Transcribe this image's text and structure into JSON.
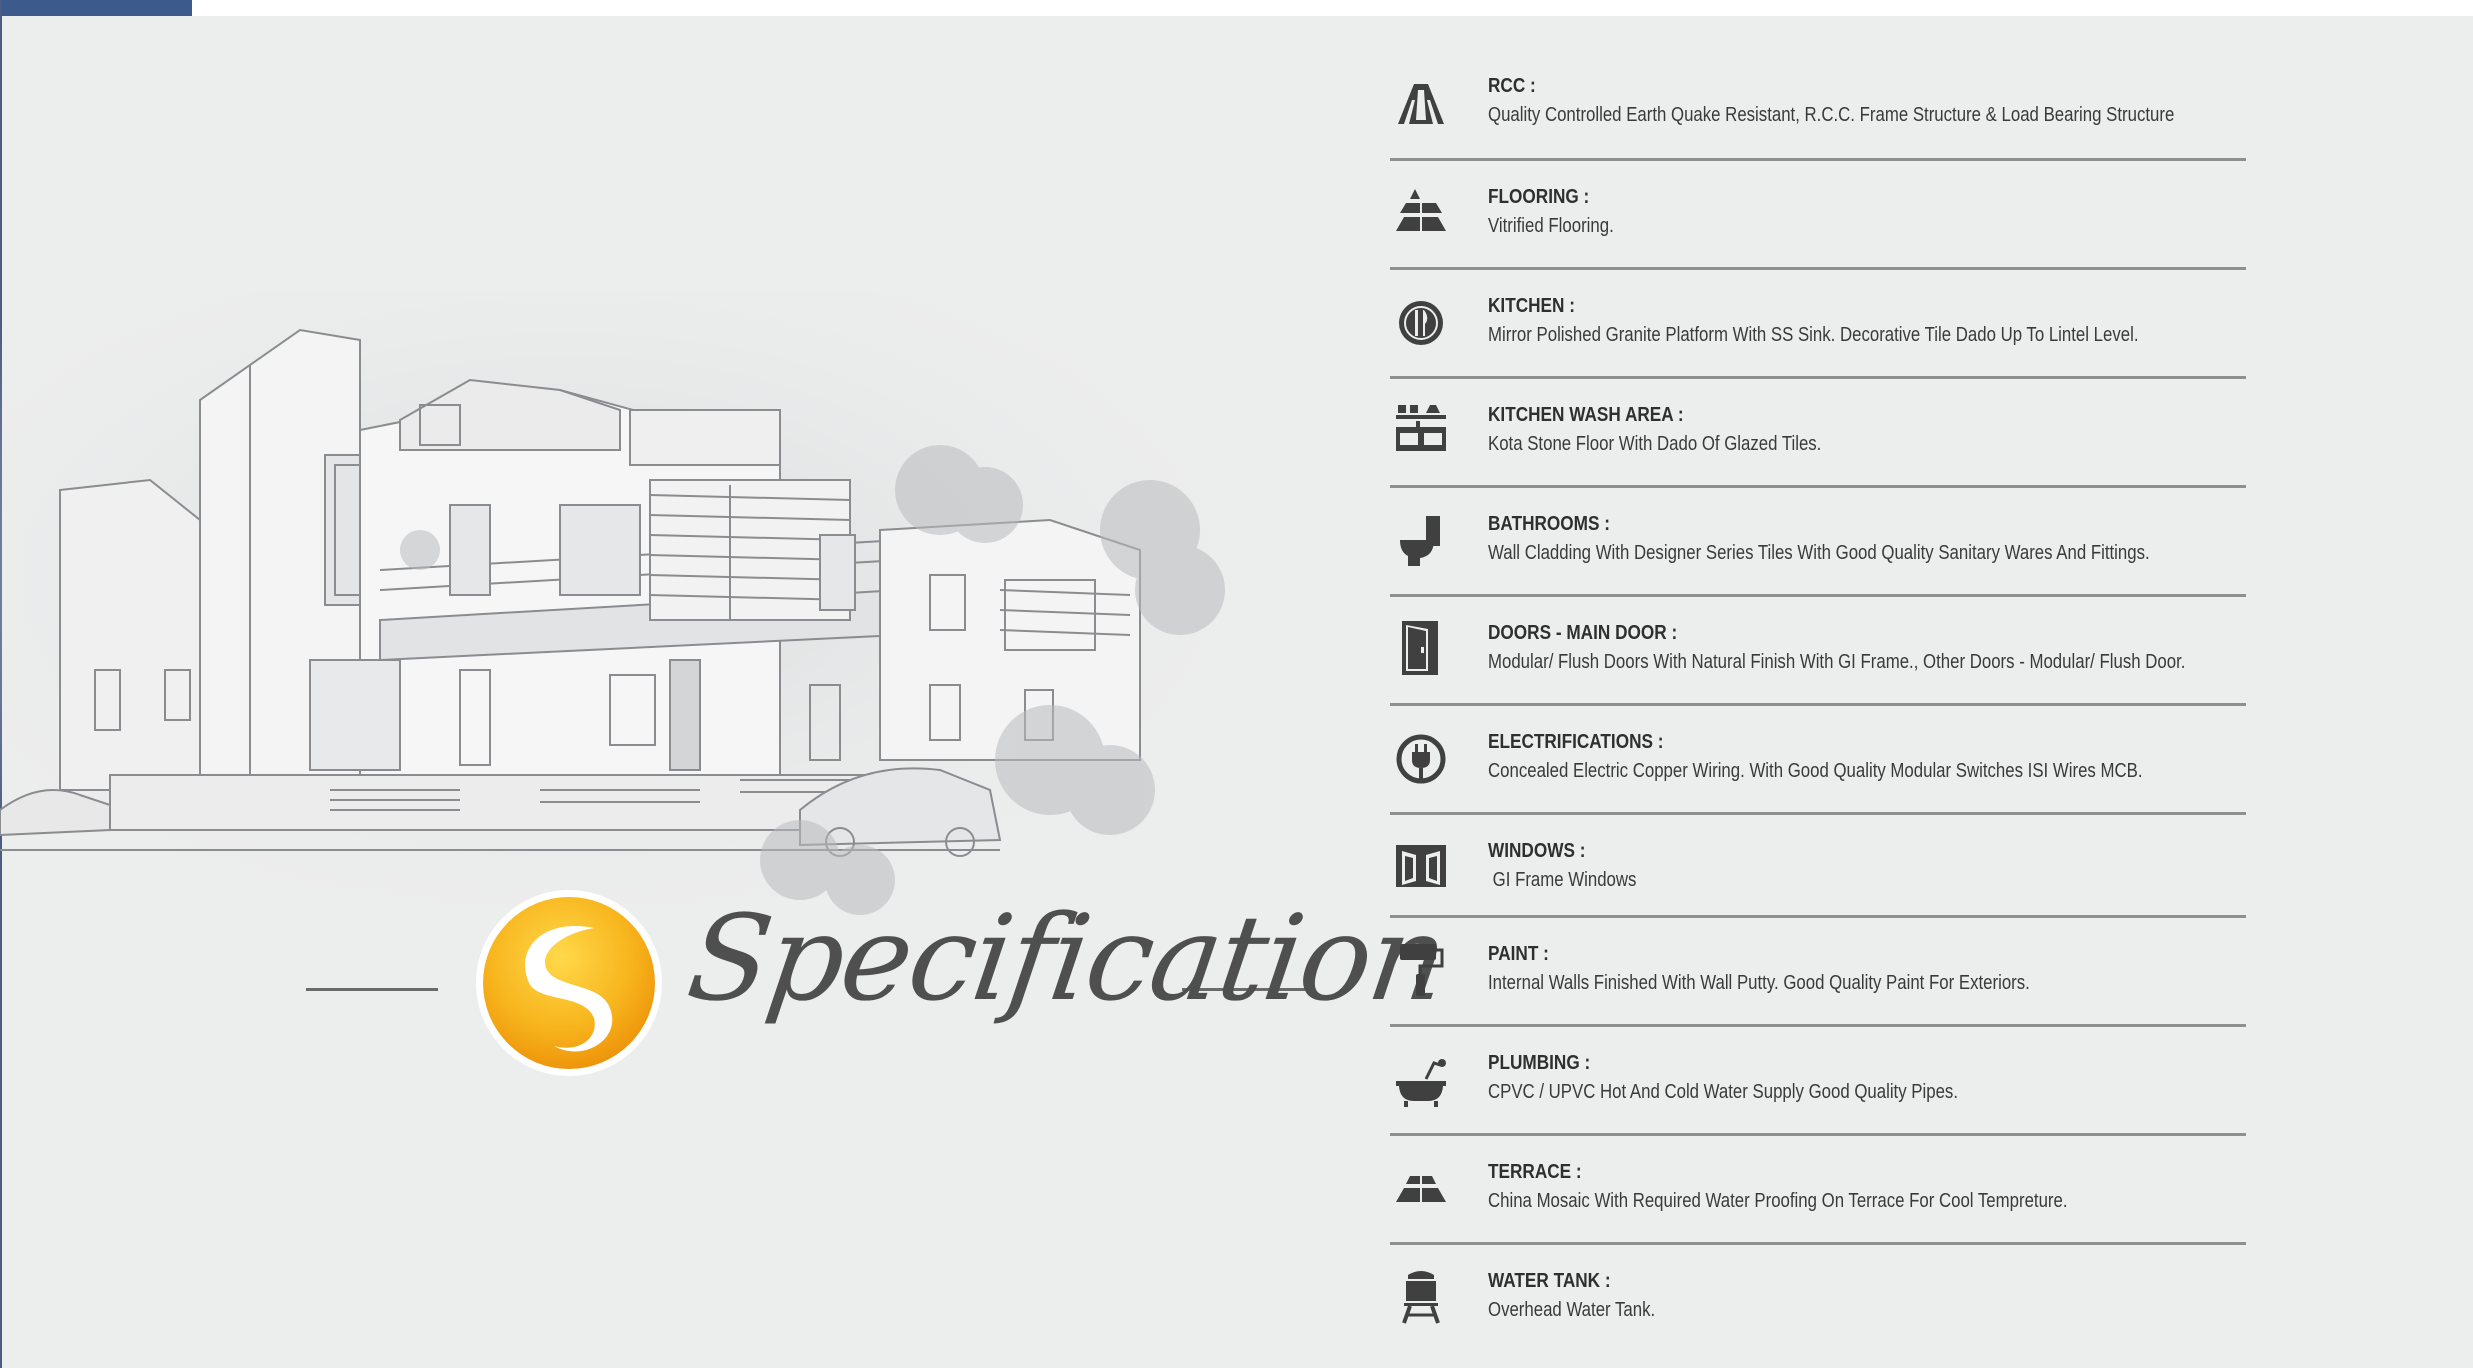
{
  "brand": {
    "accent_color": "#3c5a8c",
    "logo_colors": [
      "#f2a20c",
      "#ffd94a",
      "#ffffff"
    ]
  },
  "title": "Specification",
  "specifications": [
    {
      "icon": "road-icon",
      "title": "RCC :",
      "description": "Quality Controlled Earth Quake Resistant, R.C.C. Frame Structure & Load Bearing Structure"
    },
    {
      "icon": "floor-tiles-icon",
      "title": "FLOORING :",
      "description": "Vitrified Flooring."
    },
    {
      "icon": "dining-icon",
      "title": "KITCHEN :",
      "description": "Mirror Polished Granite Platform With SS Sink. Decorative Tile Dado Up To Lintel Level."
    },
    {
      "icon": "wash-area-icon",
      "title": "KITCHEN WASH AREA :",
      "description": "Kota Stone Floor With Dado Of Glazed Tiles."
    },
    {
      "icon": "toilet-icon",
      "title": "BATHROOMS :",
      "description": "Wall Cladding With Designer Series Tiles With Good Quality Sanitary Wares And Fittings."
    },
    {
      "icon": "door-icon",
      "title": "DOORS - MAIN DOOR :",
      "description": "Modular/ Flush Doors With Natural Finish With GI Frame., Other Doors - Modular/ Flush Door."
    },
    {
      "icon": "plug-icon",
      "title": "ELECTRIFICATIONS :",
      "description": "Concealed Electric Copper Wiring. With Good Quality Modular Switches ISI Wires MCB."
    },
    {
      "icon": "window-icon",
      "title": "WINDOWS :",
      "description": " GI Frame Windows"
    },
    {
      "icon": "paint-roller-icon",
      "title": "PAINT :",
      "description": "Internal Walls Finished With Wall Putty. Good Quality  Paint For Exteriors."
    },
    {
      "icon": "bathtub-icon",
      "title": "PLUMBING :",
      "description": "CPVC / UPVC Hot And Cold Water Supply Good Quality Pipes."
    },
    {
      "icon": "terrace-icon",
      "title": "TERRACE :",
      "description": "China Mosaic With Required Water Proofing On Terrace For Cool Tempreture."
    },
    {
      "icon": "water-tank-icon",
      "title": "WATER TANK :",
      "description": "Overhead Water Tank."
    }
  ]
}
